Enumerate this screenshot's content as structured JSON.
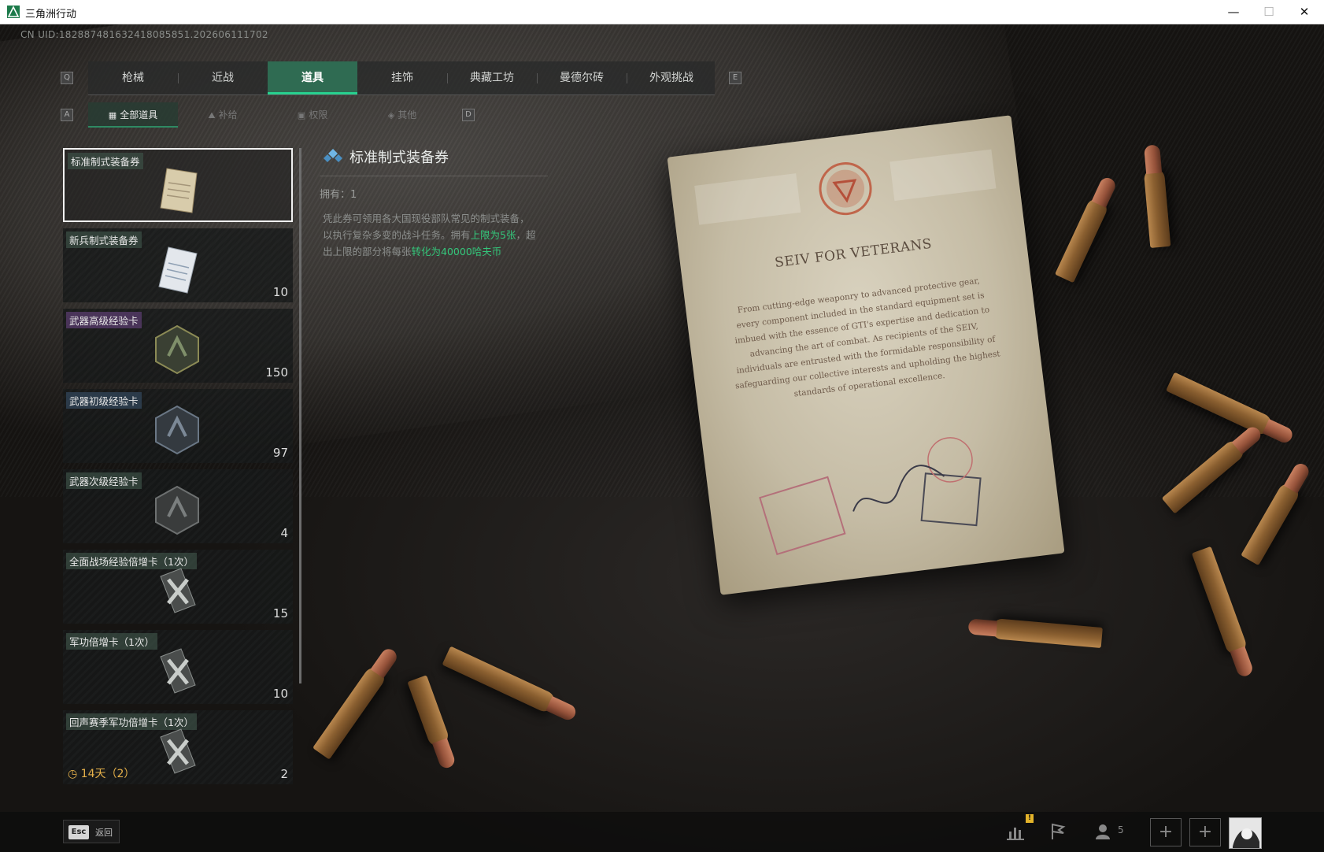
{
  "window": {
    "title": "三角洲行动",
    "minimize": "—",
    "maximize": "☐",
    "close": "✕"
  },
  "uid": "CN UID:182887481632418085851.202606111702",
  "tabs": {
    "left_key": "Q",
    "right_key": "E",
    "items": [
      {
        "label": "枪械"
      },
      {
        "label": "近战"
      },
      {
        "label": "道具",
        "active": true
      },
      {
        "label": "挂饰"
      },
      {
        "label": "典藏工坊"
      },
      {
        "label": "曼德尔砖"
      },
      {
        "label": "外观挑战"
      }
    ]
  },
  "subtabs": {
    "left_key": "A",
    "right_key": "D",
    "items": [
      {
        "label": "全部道具",
        "icon": "grid-icon",
        "active": true
      },
      {
        "label": "补给",
        "icon": "supply-icon"
      },
      {
        "label": "权限",
        "icon": "lock-icon"
      },
      {
        "label": "其他",
        "icon": "diamond-icon"
      }
    ]
  },
  "items": [
    {
      "name": "标准制式装备券",
      "count": "",
      "selected": true,
      "style": "green",
      "image": "document-icon"
    },
    {
      "name": "新兵制式装备券",
      "count": "10",
      "style": "green",
      "image": "document-icon"
    },
    {
      "name": "武器高级经验卡",
      "count": "150",
      "style": "purple",
      "image": "hexagon-card-icon"
    },
    {
      "name": "武器初级经验卡",
      "count": "97",
      "style": "blue",
      "image": "hexagon-card-icon"
    },
    {
      "name": "武器次级经验卡",
      "count": "4",
      "style": "green",
      "image": "hexagon-card-icon"
    },
    {
      "name": "全面战场经验倍增卡（1次）",
      "count": "15",
      "style": "green",
      "image": "multiplier-card-icon"
    },
    {
      "name": "军功倍增卡（1次）",
      "count": "10",
      "style": "green",
      "image": "multiplier-card-icon"
    },
    {
      "name": "回声赛季军功倍增卡（1次）",
      "count": "2",
      "style": "green",
      "image": "multiplier-card-icon",
      "timer": "14天（2）"
    }
  ],
  "detail": {
    "title": "标准制式装备券",
    "own_label": "拥有：1",
    "desc_1": "凭此券可领用各大国现役部队常见的制式装备，以执行复杂多变的战斗任务。拥有",
    "desc_hl_1": "上限为5张",
    "desc_2": "，超出上限的部分将每张",
    "desc_hl_2": "转化为40000哈夫币"
  },
  "document": {
    "title": "SEIV FOR VETERANS",
    "body": "From cutting-edge weaponry to advanced protective gear, every component included in the standard equipment set is imbued with the essence of GTI's expertise and dedication to advancing the art of combat. As recipients of the SEIV, individuals are entrusted with the formidable responsibility of safeguarding our collective interests and upholding the highest standards of operational excellence."
  },
  "bottom": {
    "esc_key": "Esc",
    "esc_label": "返回",
    "alert": "!",
    "friends_count": "5",
    "plus": "+"
  },
  "colors": {
    "accent": "#27d18f",
    "tab_active_bg": "#2f6b52",
    "highlight_text": "#34c77b",
    "timer": "#e6b14a"
  }
}
